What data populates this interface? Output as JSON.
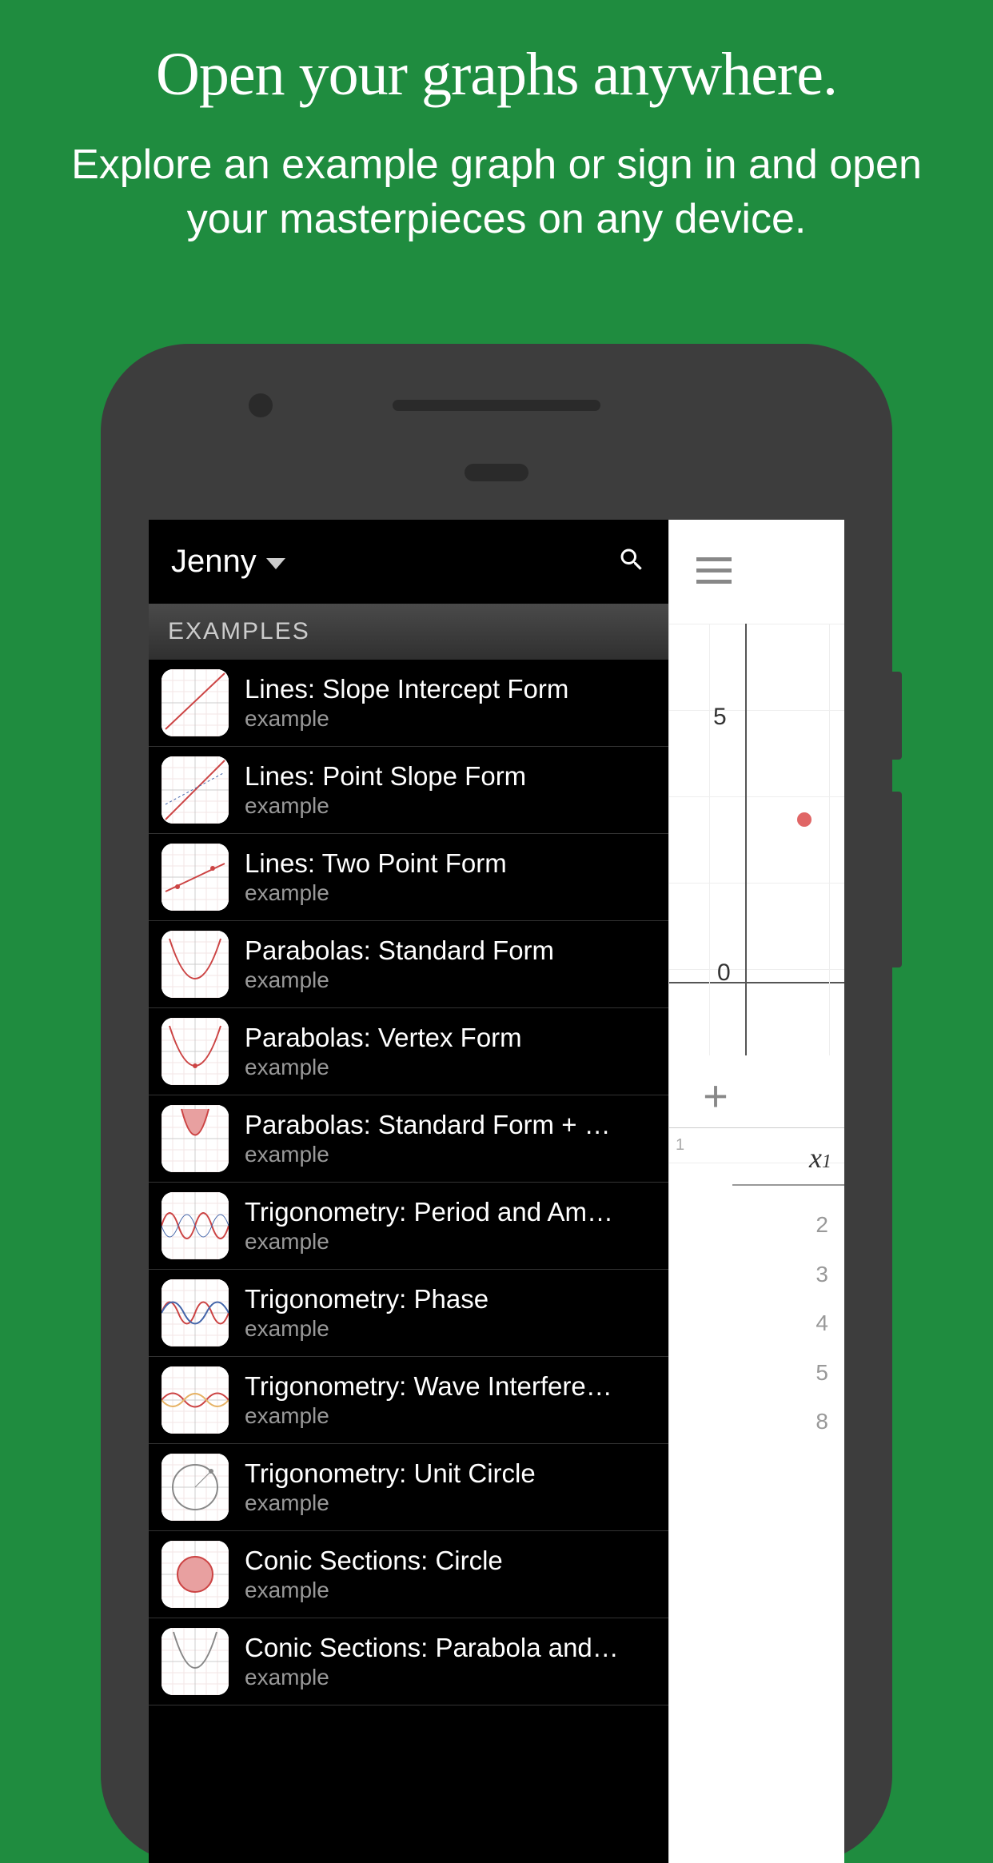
{
  "promo": {
    "headline": "Open your graphs anywhere.",
    "subhead": "Explore an example graph or sign in and open your masterpieces on any device."
  },
  "sidebar": {
    "username": "Jenny",
    "section_label": "EXAMPLES",
    "subtitle": "example",
    "items": [
      {
        "title": "Lines: Slope Intercept Form",
        "thumb": "line1"
      },
      {
        "title": "Lines: Point Slope Form",
        "thumb": "line2"
      },
      {
        "title": "Lines: Two Point Form",
        "thumb": "line3"
      },
      {
        "title": "Parabolas: Standard Form",
        "thumb": "parab1"
      },
      {
        "title": "Parabolas: Vertex Form",
        "thumb": "parab2"
      },
      {
        "title": "Parabolas: Standard Form + …",
        "thumb": "parab3"
      },
      {
        "title": "Trigonometry: Period and Am…",
        "thumb": "trig1"
      },
      {
        "title": "Trigonometry: Phase",
        "thumb": "trig2"
      },
      {
        "title": "Trigonometry: Wave Interfere…",
        "thumb": "trig3"
      },
      {
        "title": "Trigonometry: Unit Circle",
        "thumb": "circle1"
      },
      {
        "title": "Conic Sections: Circle",
        "thumb": "circle2"
      },
      {
        "title": "Conic Sections: Parabola and…",
        "thumb": "parab4"
      }
    ]
  },
  "graph": {
    "y_tick_5": "5",
    "origin_label": "0",
    "expr_index": "1",
    "table_var": "x",
    "table_sub": "1",
    "table_vals": [
      "2",
      "3",
      "4",
      "5",
      "8"
    ]
  }
}
